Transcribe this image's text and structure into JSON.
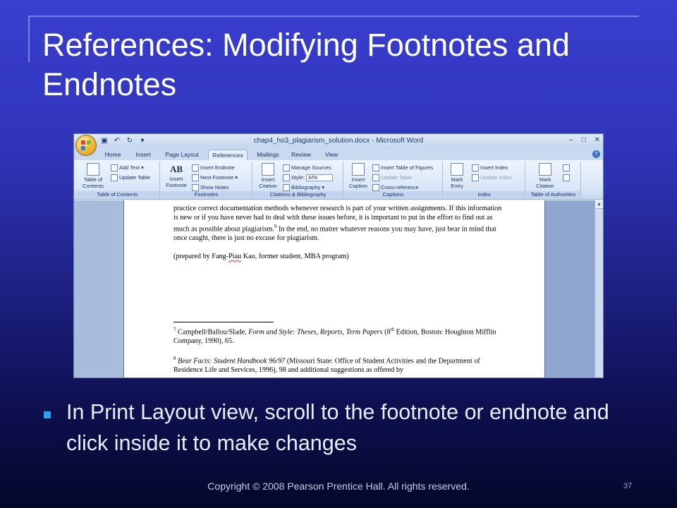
{
  "slide": {
    "title": "References: Modifying Footnotes and Endnotes",
    "bullet": "In Print Layout view, scroll to the footnote or endnote and  click inside it to make changes",
    "footer": "Copyright © 2008 Pearson Prentice Hall. All rights reserved.",
    "page_number": "37"
  },
  "word": {
    "window_title": "chap4_ho3_plagiarism_solution.docx - Microsoft Word",
    "tabs": [
      "Home",
      "Insert",
      "Page Layout",
      "References",
      "Mailings",
      "Review",
      "View"
    ],
    "active_tab": "References",
    "ribbon": {
      "toc": {
        "big": "Table of Contents",
        "add_text": "Add Text",
        "update_table": "Update Table",
        "label": "Table of Contents"
      },
      "footnotes": {
        "big": "Insert Footnote",
        "insert_endnote": "Insert Endnote",
        "next_footnote": "Next Footnote",
        "show_notes": "Show Notes",
        "label": "Footnotes",
        "ab_glyph": "AB"
      },
      "citations": {
        "big": "Insert Citation",
        "manage_sources": "Manage Sources",
        "style_label": "Style:",
        "style_value": "APA",
        "bibliography": "Bibliography",
        "label": "Citations & Bibliography"
      },
      "captions": {
        "big": "Insert Caption",
        "insert_tof": "Insert Table of Figures",
        "update_table": "Update Table",
        "cross_reference": "Cross-reference",
        "label": "Captions"
      },
      "index": {
        "big": "Mark Entry",
        "insert_index": "Insert Index",
        "update_index": "Update Index",
        "label": "Index"
      },
      "authorities": {
        "big": "Mark Citation",
        "label": "Table of Authorities"
      }
    },
    "document": {
      "para1_a": "practice correct documentation methods whenever research is part of your written assignments. If this information is new or if you have never had to deal with these issues before, it is important to put in the effort to find out as much as possible about plagiarism.",
      "para1_sup": "9",
      "para1_b": " In the end, no matter whatever reasons you may have, just bear in mind that once caught, there is just no excuse for plagiarism.",
      "para2_a": "(prepared by Fang-",
      "para2_sq": "Piau",
      "para2_b": " Kao, former student, MBA program)",
      "fn7_num": "7",
      "fn7_a": " Campbell/",
      "fn7_sq": "Ballou",
      "fn7_b": "/Slade, ",
      "fn7_italic": "Form and Style: Theses, Reports, Term Papers",
      "fn7_c": " (8",
      "fn7_th": "th",
      "fn7_d": " Edition, Boston: Houghton Mifflin Company, 1990), 65.",
      "fn8_num": "8",
      "fn8_italic": " Bear Facts: Student Handbook 96/97",
      "fn8_a": " (",
      "fn8_sq": "Missouri",
      "fn8_b": "  State: Office of Student Activities and the Department of Residence Life and Services, 1996), 98 and additional suggestions as offered by"
    }
  },
  "colors": {
    "bullet": "#27a4ef",
    "background_top": "#3a3fcf",
    "background_bottom": "#05062a"
  }
}
